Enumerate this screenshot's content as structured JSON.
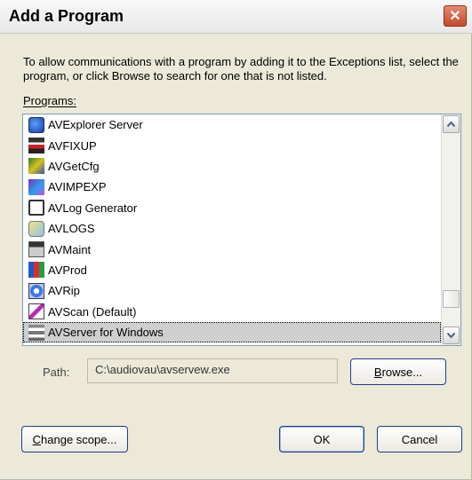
{
  "window": {
    "title": "Add a Program",
    "close_symbol": "✕"
  },
  "description": "To allow communications with a program by adding it to the Exceptions list, select the program, or click Browse to search for one that is not listed.",
  "programs_label": {
    "mnemonic": "P",
    "rest": "rograms:"
  },
  "programs": [
    {
      "name": "AVExplorer Server",
      "icon": "av-explorer-icon"
    },
    {
      "name": "AVFIXUP",
      "icon": "av-fixup-icon"
    },
    {
      "name": "AVGetCfg",
      "icon": "av-getcfg-icon"
    },
    {
      "name": "AVIMPEXP",
      "icon": "av-impexp-icon"
    },
    {
      "name": "AVLog Generator",
      "icon": "av-log-generator-icon"
    },
    {
      "name": "AVLOGS",
      "icon": "av-logs-icon"
    },
    {
      "name": "AVMaint",
      "icon": "av-maint-icon"
    },
    {
      "name": "AVProd",
      "icon": "av-prod-icon"
    },
    {
      "name": "AVRip",
      "icon": "av-rip-icon"
    },
    {
      "name": "AVScan (Default)",
      "icon": "av-scan-icon"
    },
    {
      "name": "AVServer for Windows",
      "icon": "av-server-icon",
      "selected": true
    }
  ],
  "path": {
    "label": "Path:",
    "value": "C:\\audiovau\\avservew.exe"
  },
  "buttons": {
    "browse": {
      "mnemonic": "B",
      "rest": "rowse..."
    },
    "change_scope": {
      "mnemonic": "C",
      "rest": "hange scope..."
    },
    "ok": "OK",
    "cancel": "Cancel"
  },
  "scroll_position": 0.9
}
